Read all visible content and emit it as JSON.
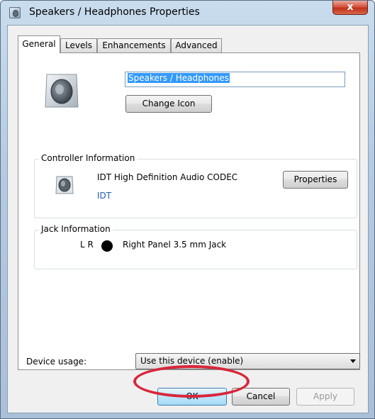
{
  "window": {
    "title": "Speakers / Headphones Properties",
    "close_label": "x"
  },
  "tabs": [
    {
      "label": "General",
      "active": true
    },
    {
      "label": "Levels",
      "active": false
    },
    {
      "label": "Enhancements",
      "active": false
    },
    {
      "label": "Advanced",
      "active": false
    }
  ],
  "device": {
    "icon": "speaker-icon",
    "name_value": "Speakers / Headphones",
    "change_icon_label": "Change Icon"
  },
  "controller": {
    "group_label": "Controller Information",
    "icon": "speaker-icon",
    "name": "IDT High Definition Audio CODEC",
    "vendor": "IDT",
    "properties_label": "Properties"
  },
  "jack": {
    "group_label": "Jack Information",
    "channels": "L R",
    "color": "#000000",
    "description": "Right Panel 3.5 mm Jack"
  },
  "usage": {
    "label": "Device usage:",
    "selected": "Use this device (enable)"
  },
  "buttons": {
    "ok": "OK",
    "cancel": "Cancel",
    "apply": "Apply"
  },
  "annotation": {
    "highlight_color": "#d9263b"
  }
}
